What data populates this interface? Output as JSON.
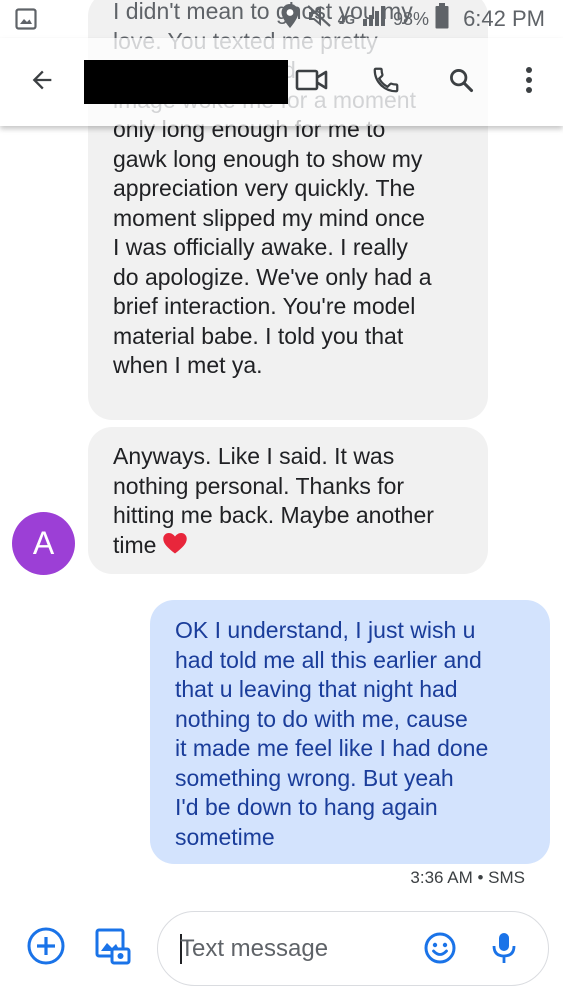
{
  "status_bar": {
    "network": "4G",
    "battery": "98%",
    "time": "6:42 PM"
  },
  "header": {
    "contact_name": ""
  },
  "thread": {
    "incoming_1_behind_header": "I didn't mean to ghost you my\nlove. You texted me pretty\nfor ... that blessed\nimage woke me for a moment",
    "incoming_1": "only long enough for me to\ngawk long enough to show my\nappreciation very quickly. The\nmoment slipped my mind once\nI was officially awake. I really\ndo apologize. We've only had a\nbrief interaction. You're model\nmaterial babe. I told you that\nwhen I met ya.",
    "incoming_2": "Anyways. Like I said. It was\nnothing personal. Thanks for\nhitting me back. Maybe another\ntime",
    "avatar_initial": "A",
    "outgoing_1": "OK I understand, I just wish u\nhad told me all this earlier and\nthat u leaving that night had\nnothing to do with me, cause\nit made me feel like I had done\nsomething wrong. But yeah\nI'd be down to hang again\nsometime",
    "outgoing_meta": "3:36 AM • SMS"
  },
  "composer": {
    "placeholder": "Text message"
  },
  "colors": {
    "incoming_bubble": "#f1f1f1",
    "outgoing_bubble": "#d3e3fd",
    "outgoing_text": "#1a3d9a",
    "accent": "#1a73e8",
    "avatar": "#9c3fd6",
    "heart": "#e8263b"
  },
  "icons": [
    "gallery-icon",
    "location-icon",
    "mute-icon",
    "signal-icon",
    "battery-icon",
    "back-arrow-icon",
    "video-call-icon",
    "phone-icon",
    "search-icon",
    "more-vert-icon",
    "add-icon",
    "gallery-attach-icon",
    "emoji-icon",
    "mic-icon",
    "heart-icon"
  ]
}
